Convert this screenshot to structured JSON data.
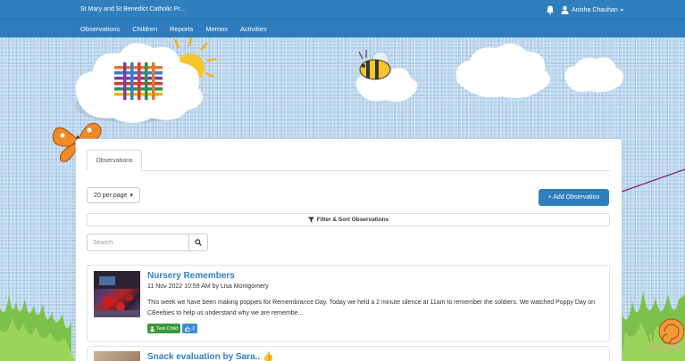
{
  "topbar": {
    "school_name": "St Mary and St Benedict Catholic Pr...",
    "user_name": "Anisha Chauhan",
    "icons": {
      "notifications": "bell-icon",
      "user": "user-icon",
      "dropdown": "caret-down-icon"
    }
  },
  "nav": {
    "items": [
      {
        "label": "Observations"
      },
      {
        "label": "Children"
      },
      {
        "label": "Reports"
      },
      {
        "label": "Memos"
      },
      {
        "label": "Activities"
      }
    ]
  },
  "panel": {
    "tab_label": "Observations",
    "per_page_label": "20 per page",
    "add_button_label": "+ Add Observation",
    "filter_label": "Filter & Sort Observations",
    "search_placeholder": "Search"
  },
  "observations": [
    {
      "title": "Nursery Remembers",
      "meta": "11 Nov 2022 10:59 AM by Lisa Montgomery",
      "text": "This week we have been making poppies for Remembrance Day. Today we held a 2 minute silence at 11am to remember the soldiers. We watched Poppy Day on CBeebies to help us understand why we are remembe...",
      "child_tag": "Test Child",
      "likes": "2"
    },
    {
      "title": "Snack evaluation by Sara.."
    }
  ],
  "colors": {
    "brand_blue": "#2f7fbf",
    "tag_green": "#3a9a3a",
    "tag_blue": "#3b8ed6",
    "sky": "#b7d3ec",
    "arrow_purple": "#7a1a7a"
  }
}
